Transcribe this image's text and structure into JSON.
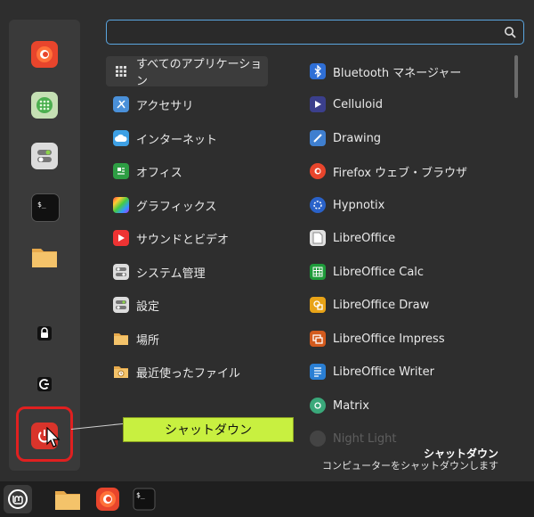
{
  "search": {
    "value": ""
  },
  "categories": [
    {
      "label": "すべてのアプリケーション",
      "icon": "grid-icon"
    },
    {
      "label": "アクセサリ",
      "icon": "accessories-icon"
    },
    {
      "label": "インターネット",
      "icon": "internet-icon"
    },
    {
      "label": "オフィス",
      "icon": "office-icon"
    },
    {
      "label": "グラフィックス",
      "icon": "graphics-icon"
    },
    {
      "label": "サウンドとビデオ",
      "icon": "sound-video-icon"
    },
    {
      "label": "システム管理",
      "icon": "system-admin-icon"
    },
    {
      "label": "設定",
      "icon": "settings-icon"
    },
    {
      "label": "場所",
      "icon": "places-folder-icon"
    },
    {
      "label": "最近使ったファイル",
      "icon": "recent-files-icon"
    }
  ],
  "apps": [
    {
      "label": "Bluetooth マネージャー",
      "icon": "bluetooth-icon"
    },
    {
      "label": "Celluloid",
      "icon": "celluloid-icon"
    },
    {
      "label": "Drawing",
      "icon": "drawing-icon"
    },
    {
      "label": "Firefox ウェブ・ブラウザ",
      "icon": "firefox-icon"
    },
    {
      "label": "Hypnotix",
      "icon": "hypnotix-icon"
    },
    {
      "label": "LibreOffice",
      "icon": "libreoffice-icon"
    },
    {
      "label": "LibreOffice Calc",
      "icon": "libreoffice-calc-icon"
    },
    {
      "label": "LibreOffice Draw",
      "icon": "libreoffice-draw-icon"
    },
    {
      "label": "LibreOffice Impress",
      "icon": "libreoffice-impress-icon"
    },
    {
      "label": "LibreOffice Writer",
      "icon": "libreoffice-writer-icon"
    },
    {
      "label": "Matrix",
      "icon": "matrix-icon"
    },
    {
      "label": "Night Light",
      "icon": "night-light-icon"
    }
  ],
  "tooltip": {
    "text": "シャットダウン"
  },
  "status": {
    "title": "シャットダウン",
    "description": "コンピューターをシャットダウンします"
  },
  "colors": {
    "accent": "#5aa6e0",
    "highlight": "#e02020",
    "tooltip": "#c8f040"
  }
}
